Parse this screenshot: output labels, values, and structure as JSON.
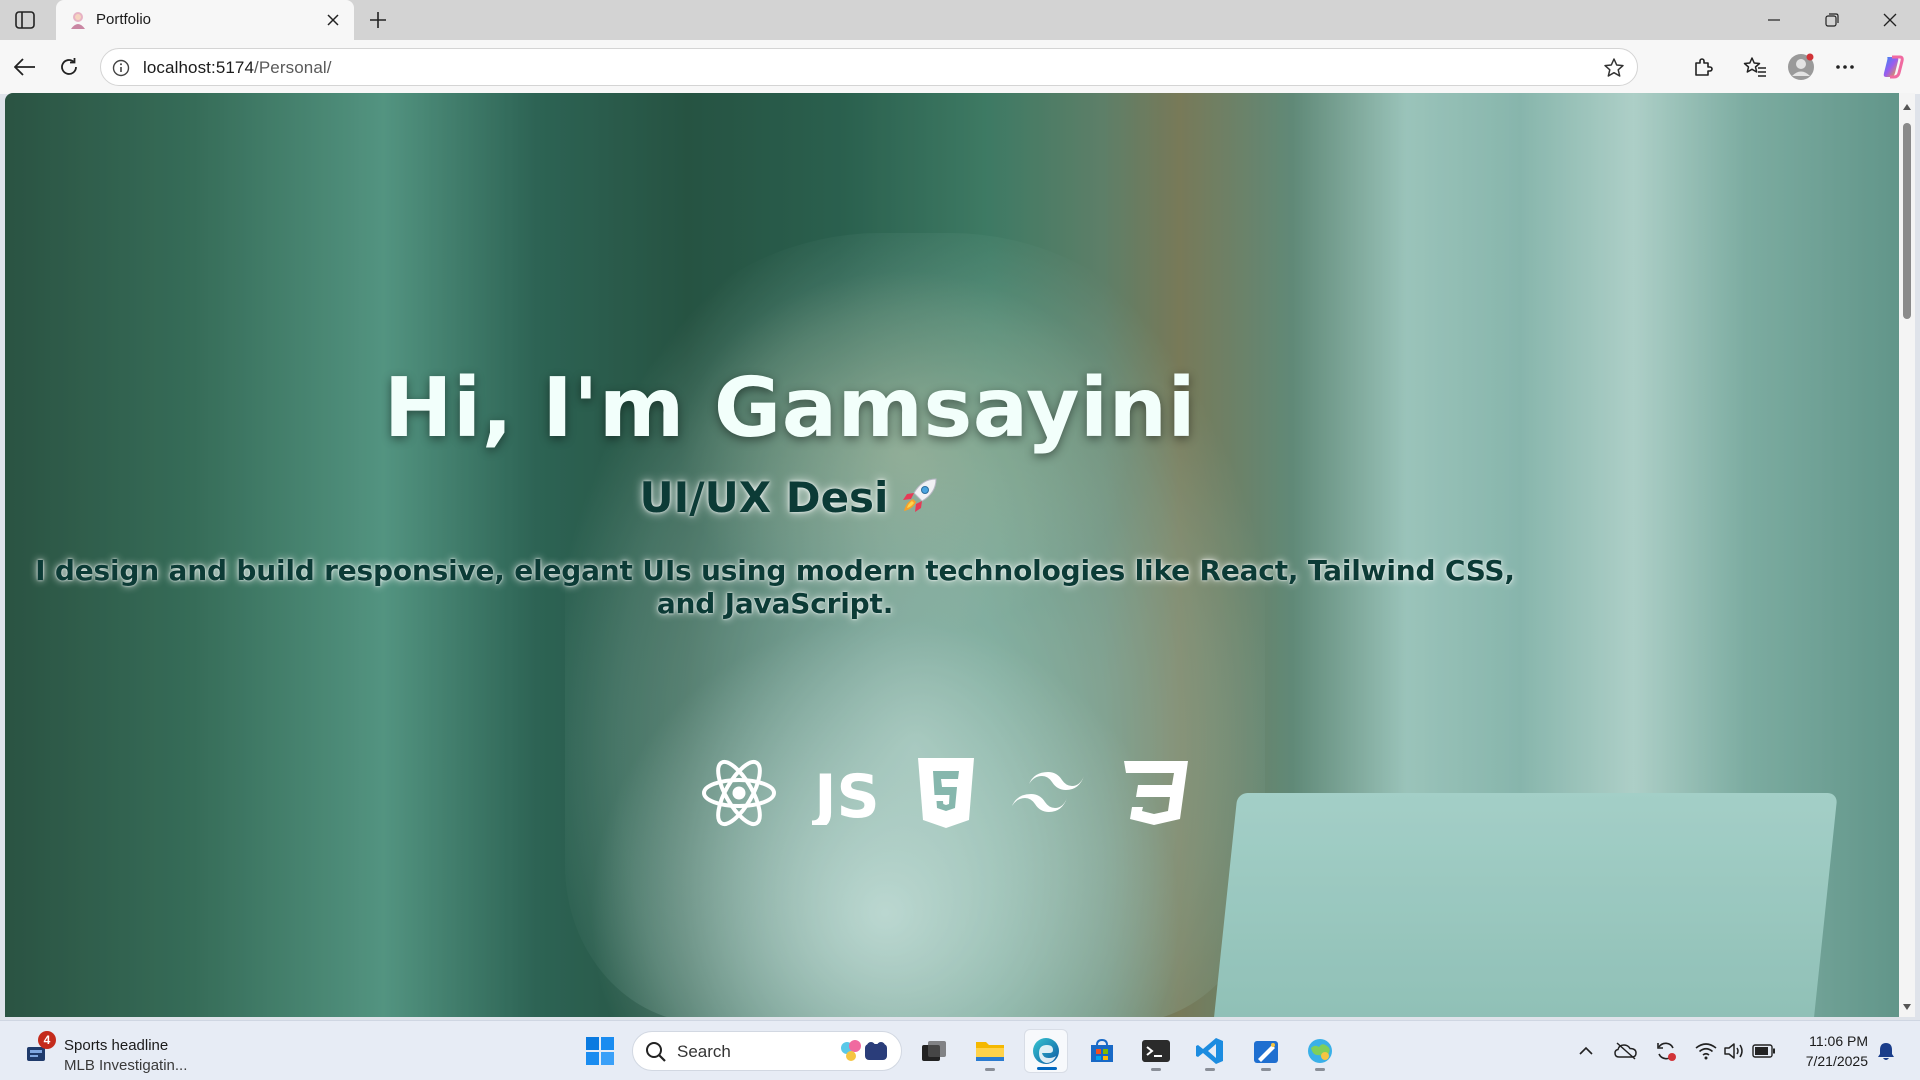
{
  "browser": {
    "tab_title": "Portfolio",
    "url_host": "localhost:5174",
    "url_path": "/Personal/"
  },
  "hero": {
    "title": "Hi, I'm Gamsayini",
    "subtitle": "UI/UX Desi",
    "description": "I design and build responsive, elegant UIs using modern technologies like React, Tailwind CSS, and JavaScript.",
    "tech_icons": [
      "react-icon",
      "javascript-icon",
      "html5-icon",
      "tailwind-icon",
      "css3-icon"
    ],
    "tech_labels": {
      "js": "JS"
    }
  },
  "taskbar": {
    "widget_badge": "4",
    "widget_title": "Sports headline",
    "widget_subtitle": "MLB Investigatin...",
    "search_label": "Search",
    "clock_time": "11:06 PM",
    "clock_date": "7/21/2025"
  },
  "colors": {
    "title_text": "#f2fffb",
    "body_text": "#0c3b36",
    "accent_blue": "#0067c0",
    "badge_red": "#c42b1c"
  }
}
